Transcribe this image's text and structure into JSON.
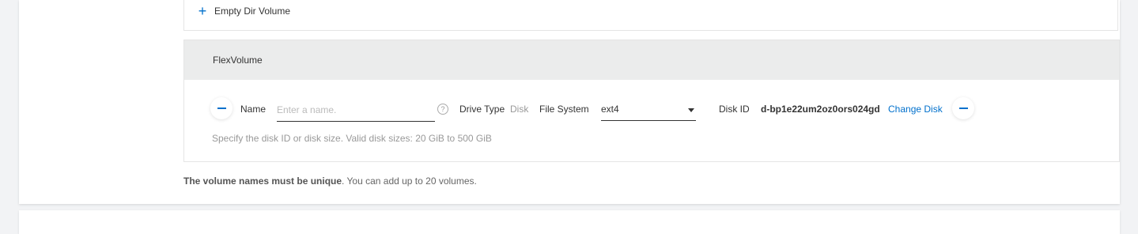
{
  "empty_dir": {
    "add_icon": "plus-icon",
    "label": "Empty Dir Volume"
  },
  "flex_volume": {
    "title": "FlexVolume",
    "remove_icon": "minus-icon",
    "name_label": "Name",
    "name_value": "",
    "name_placeholder": "Enter a name.",
    "help_icon": "question-circle-icon",
    "drive_type_label": "Drive Type",
    "drive_type_value": "Disk",
    "file_system_label": "File System",
    "file_system_value": "ext4",
    "disk_id_label": "Disk ID",
    "disk_id_value": "d-bp1e22um2oz0ors024gd",
    "change_disk_label": "Change Disk",
    "hint": "Specify the disk ID or disk size. Valid disk sizes: 20 GiB to 500 GiB"
  },
  "footer": {
    "bold": "The volume names must be unique",
    "rest": ". You can add up to 20 volumes."
  },
  "colors": {
    "accent": "#0070cc",
    "header_bg": "#ebecec"
  }
}
